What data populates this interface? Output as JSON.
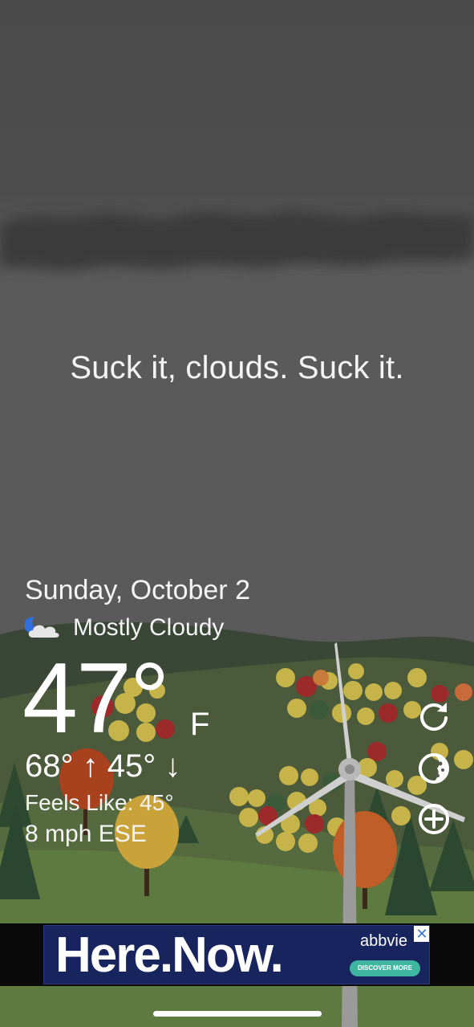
{
  "scene": {
    "tagline": "Suck it, clouds. Suck it."
  },
  "weather": {
    "date": "Sunday, October 2",
    "condition_icon": "partly-cloudy-night-icon",
    "condition": "Mostly Cloudy",
    "temperature": "47°",
    "unit": "F",
    "high_low": "68° ↑  45° ↓",
    "feels_like": "Feels Like: 45°",
    "wind": "8 mph ESE"
  },
  "controls": [
    {
      "icon": "refresh-icon"
    },
    {
      "icon": "theme-icon"
    },
    {
      "icon": "add-icon"
    }
  ],
  "ad": {
    "headline": "Here.Now.",
    "brand": "abbvie",
    "cta": "DISCOVER MORE",
    "close": "✕"
  },
  "colors": {
    "sky": "#585858",
    "hills": "#3d4a35",
    "ad_background": "#17245e",
    "cta": "#3fb6a0"
  }
}
